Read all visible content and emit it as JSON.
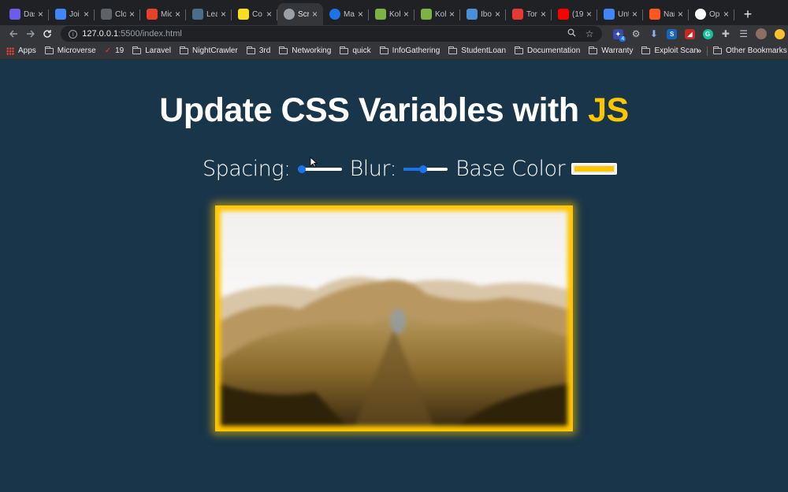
{
  "browser": {
    "tabs": [
      {
        "title": "Das",
        "icon": "dashboard-icon",
        "color": "#6c5ce7"
      },
      {
        "title": "Joi",
        "icon": "joinme-icon",
        "color": "#4285f4"
      },
      {
        "title": "Clo",
        "icon": "clockify-icon",
        "color": "#5f6368"
      },
      {
        "title": "Mic",
        "icon": "gitlab-icon",
        "color": "#e24329"
      },
      {
        "title": "Lea",
        "icon": "learning-icon",
        "color": "#4a6d8c"
      },
      {
        "title": "Co",
        "icon": "codepen-icon",
        "color": "#f7df1e"
      },
      {
        "title": "Scr",
        "icon": "loading-icon",
        "color": "#9aa0a6",
        "active": true
      },
      {
        "title": "Ma",
        "icon": "spinner-icon",
        "color": "#1a73e8"
      },
      {
        "title": "Koh",
        "icon": "koha-icon",
        "color": "#7cb342"
      },
      {
        "title": "Koh",
        "icon": "koha-icon",
        "color": "#7cb342"
      },
      {
        "title": "Ibo",
        "icon": "ibook-icon",
        "color": "#4a90d9"
      },
      {
        "title": "Tor",
        "icon": "tomato-icon",
        "color": "#e53935"
      },
      {
        "title": "(19",
        "icon": "youtube-icon",
        "color": "#ff0000"
      },
      {
        "title": "Unt",
        "icon": "docs-icon",
        "color": "#4285f4"
      },
      {
        "title": "Nar",
        "icon": "analytics-icon",
        "color": "#ff5722"
      },
      {
        "title": "Op",
        "icon": "github-icon",
        "color": "#ffffff"
      }
    ],
    "new_tab_label": "+",
    "url": {
      "host": "127.0.0.1",
      "path": ":5500/index.html"
    },
    "bookmarks": [
      {
        "label": "Apps",
        "icon": "apps-grid-icon"
      },
      {
        "label": "Microverse",
        "icon": "folder-icon"
      },
      {
        "label": "19",
        "icon": "bookmark-star-icon"
      },
      {
        "label": "Laravel",
        "icon": "folder-icon"
      },
      {
        "label": "NightCrawler",
        "icon": "folder-icon"
      },
      {
        "label": "3rd",
        "icon": "folder-icon"
      },
      {
        "label": "Networking",
        "icon": "folder-icon"
      },
      {
        "label": "quick",
        "icon": "folder-icon"
      },
      {
        "label": "InfoGathering",
        "icon": "folder-icon"
      },
      {
        "label": "StudentLoan",
        "icon": "folder-icon"
      },
      {
        "label": "Documentation",
        "icon": "folder-icon"
      },
      {
        "label": "Warranty",
        "icon": "folder-icon"
      },
      {
        "label": "Exploit Scan",
        "icon": "folder-icon"
      }
    ],
    "more_bookmarks": "»",
    "other_bookmarks": "Other Bookmarks",
    "extension_badge": "4"
  },
  "page": {
    "heading_prefix": "Update CSS Variables with ",
    "heading_highlight": "JS",
    "spacing_label": "Spacing:",
    "blur_label": "Blur:",
    "base_color_label": "Base Color",
    "spacing_value": 0.0,
    "blur_value": 0.45,
    "base_color": "#ffc600",
    "background_color": "#193549"
  }
}
